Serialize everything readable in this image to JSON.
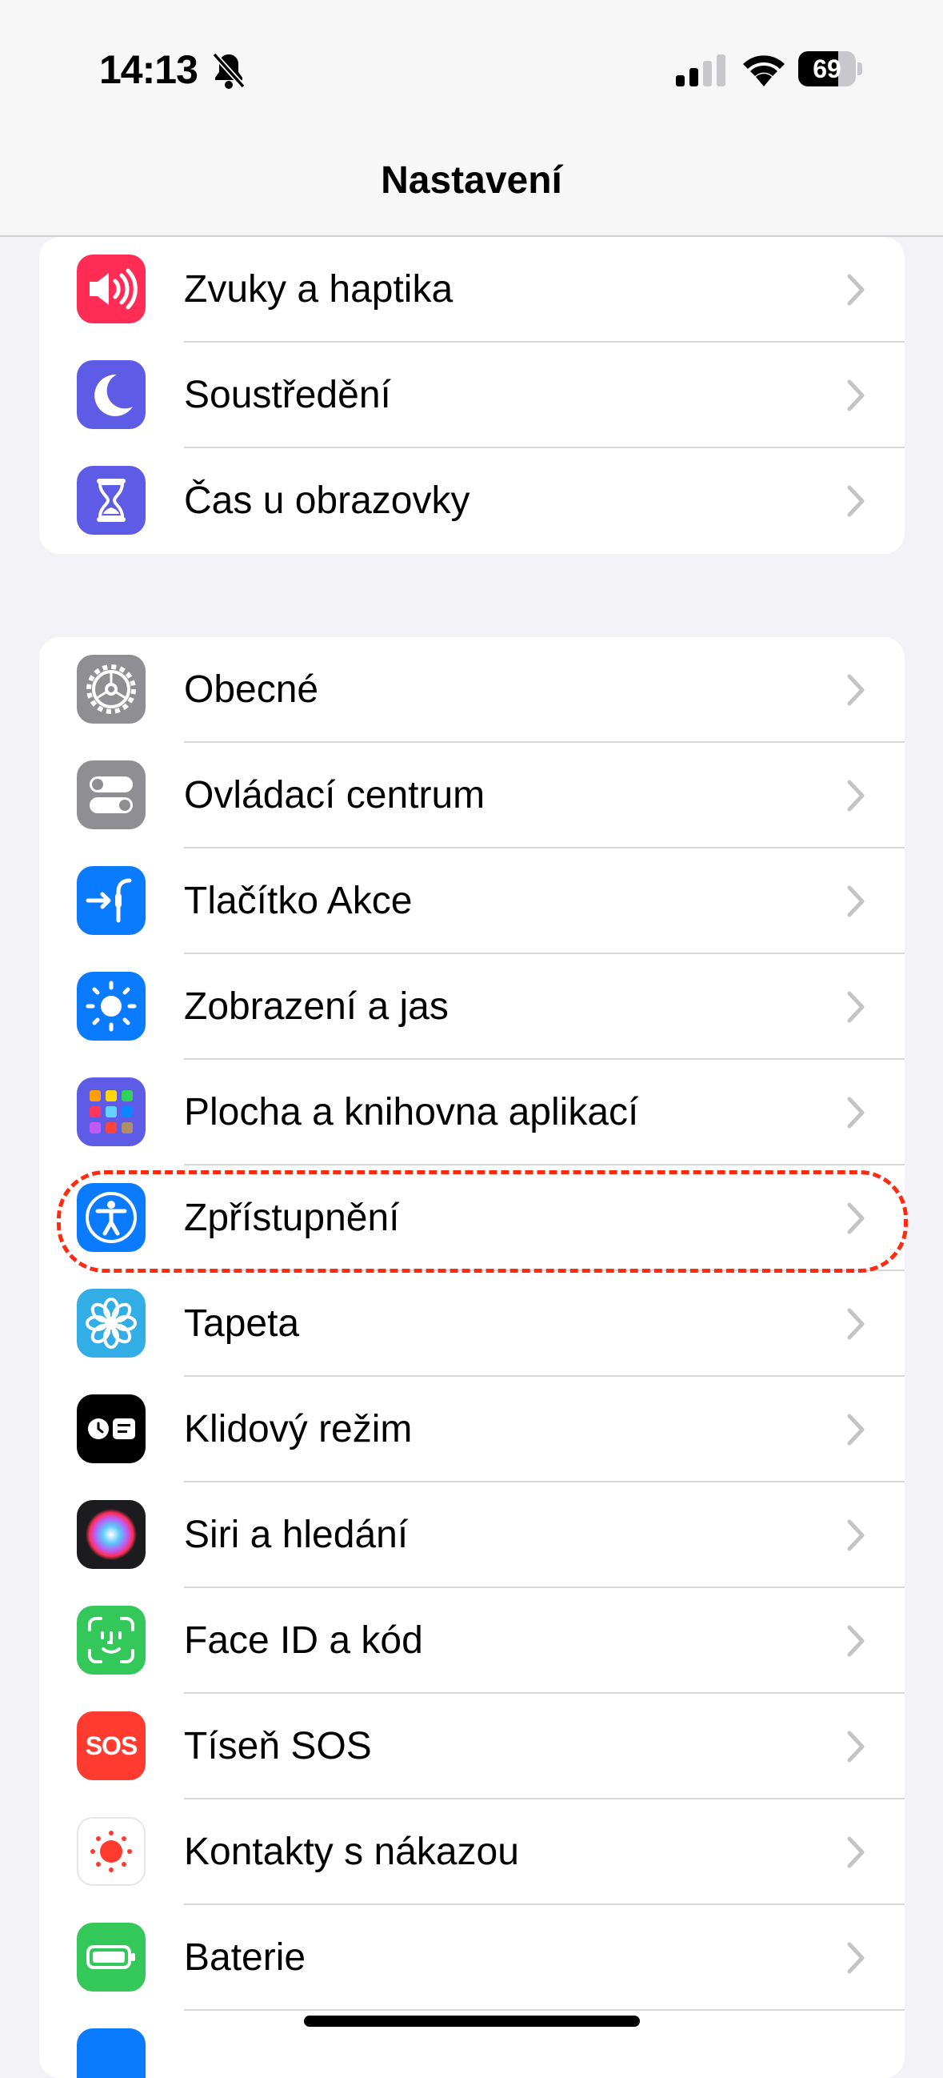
{
  "status": {
    "time": "14:13",
    "battery": "69",
    "battery_level": 0.69
  },
  "nav": {
    "title": "Nastavení"
  },
  "group1": [
    {
      "label": "Zvuky a haptika",
      "icon": "speaker-icon",
      "color": "#ff2d55"
    },
    {
      "label": "Soustředění",
      "icon": "moon-icon",
      "color": "#5e5ce6"
    },
    {
      "label": "Čas u obrazovky",
      "icon": "hourglass-icon",
      "color": "#5e5ce6"
    }
  ],
  "group2": [
    {
      "label": "Obecné",
      "icon": "gear-icon",
      "color": "#8e8e93"
    },
    {
      "label": "Ovládací centrum",
      "icon": "toggles-icon",
      "color": "#8e8e93"
    },
    {
      "label": "Tlačítko Akce",
      "icon": "action-button-icon",
      "color": "#0a7aff"
    },
    {
      "label": "Zobrazení a jas",
      "icon": "sun-icon",
      "color": "#0a7aff"
    },
    {
      "label": "Plocha a knihovna aplikací",
      "icon": "app-grid-icon",
      "color": "#5e5ce6"
    },
    {
      "label": "Zpřístupnění",
      "icon": "accessibility-icon",
      "color": "#0a7aff"
    },
    {
      "label": "Tapeta",
      "icon": "flower-icon",
      "color": "#32ade6"
    },
    {
      "label": "Klidový režim",
      "icon": "standby-icon",
      "color": "#000000"
    },
    {
      "label": "Siri a hledání",
      "icon": "siri-icon",
      "color": "#1c1c1e"
    },
    {
      "label": "Face ID a kód",
      "icon": "face-id-icon",
      "color": "#34c759"
    },
    {
      "label": "Tíseň SOS",
      "icon": "sos-icon",
      "color": "#ff3b30",
      "badge": "SOS"
    },
    {
      "label": "Kontakty s nákazou",
      "icon": "exposure-icon",
      "color": "#ffffff"
    },
    {
      "label": "Baterie",
      "icon": "battery-app-icon",
      "color": "#34c759"
    }
  ]
}
